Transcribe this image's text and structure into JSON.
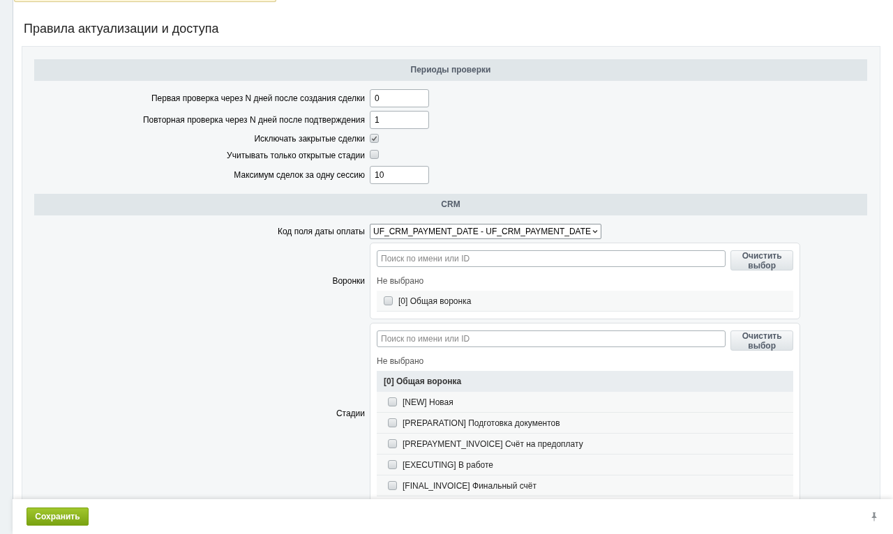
{
  "page_title": "Правила актуализации и доступа",
  "sections": [
    {
      "title": "Периоды проверки",
      "fields": [
        {
          "kind": "text",
          "label": "Первая проверка через N дней после создания сделки",
          "value": "0"
        },
        {
          "kind": "text",
          "label": "Повторная проверка через N дней после подтверждения",
          "value": "1"
        },
        {
          "kind": "checkbox",
          "label": "Исключать закрытые сделки",
          "checked": true
        },
        {
          "kind": "checkbox",
          "label": "Учитывать только открытые стадии",
          "checked": false
        },
        {
          "kind": "text",
          "label": "Максимум сделок за одну сессию",
          "value": "10"
        }
      ]
    },
    {
      "title": "CRM",
      "fields": [
        {
          "kind": "select",
          "label": "Код поля даты оплаты",
          "value": "UF_CRM_PAYMENT_DATE - UF_CRM_PAYMENT_DATE"
        },
        {
          "kind": "picker",
          "label": "Воронки",
          "placeholder": "Поиск по имени или ID",
          "clear_button": "Очистить выбор",
          "status": "Не выбрано",
          "items": [
            {
              "kind": "option",
              "label": "[0] Общая воронка",
              "checked": false
            }
          ]
        },
        {
          "kind": "picker",
          "label": "Стадии",
          "placeholder": "Поиск по имени или ID",
          "clear_button": "Очистить выбор",
          "status": "Не выбрано",
          "items": [
            {
              "kind": "group",
              "label": "[0] Общая воронка",
              "children": [
                {
                  "kind": "option",
                  "label": "[NEW] Новая",
                  "checked": false
                },
                {
                  "kind": "option",
                  "label": "[PREPARATION] Подготовка документов",
                  "checked": false
                },
                {
                  "kind": "option",
                  "label": "[PREPAYMENT_INVOICE] Счёт на предоплату",
                  "checked": false
                },
                {
                  "kind": "option",
                  "label": "[EXECUTING] В работе",
                  "checked": false
                },
                {
                  "kind": "option",
                  "label": "[FINAL_INVOICE] Финальный счёт",
                  "checked": false
                }
              ]
            }
          ]
        }
      ]
    }
  ],
  "footer": {
    "save_button": "Сохранить"
  }
}
